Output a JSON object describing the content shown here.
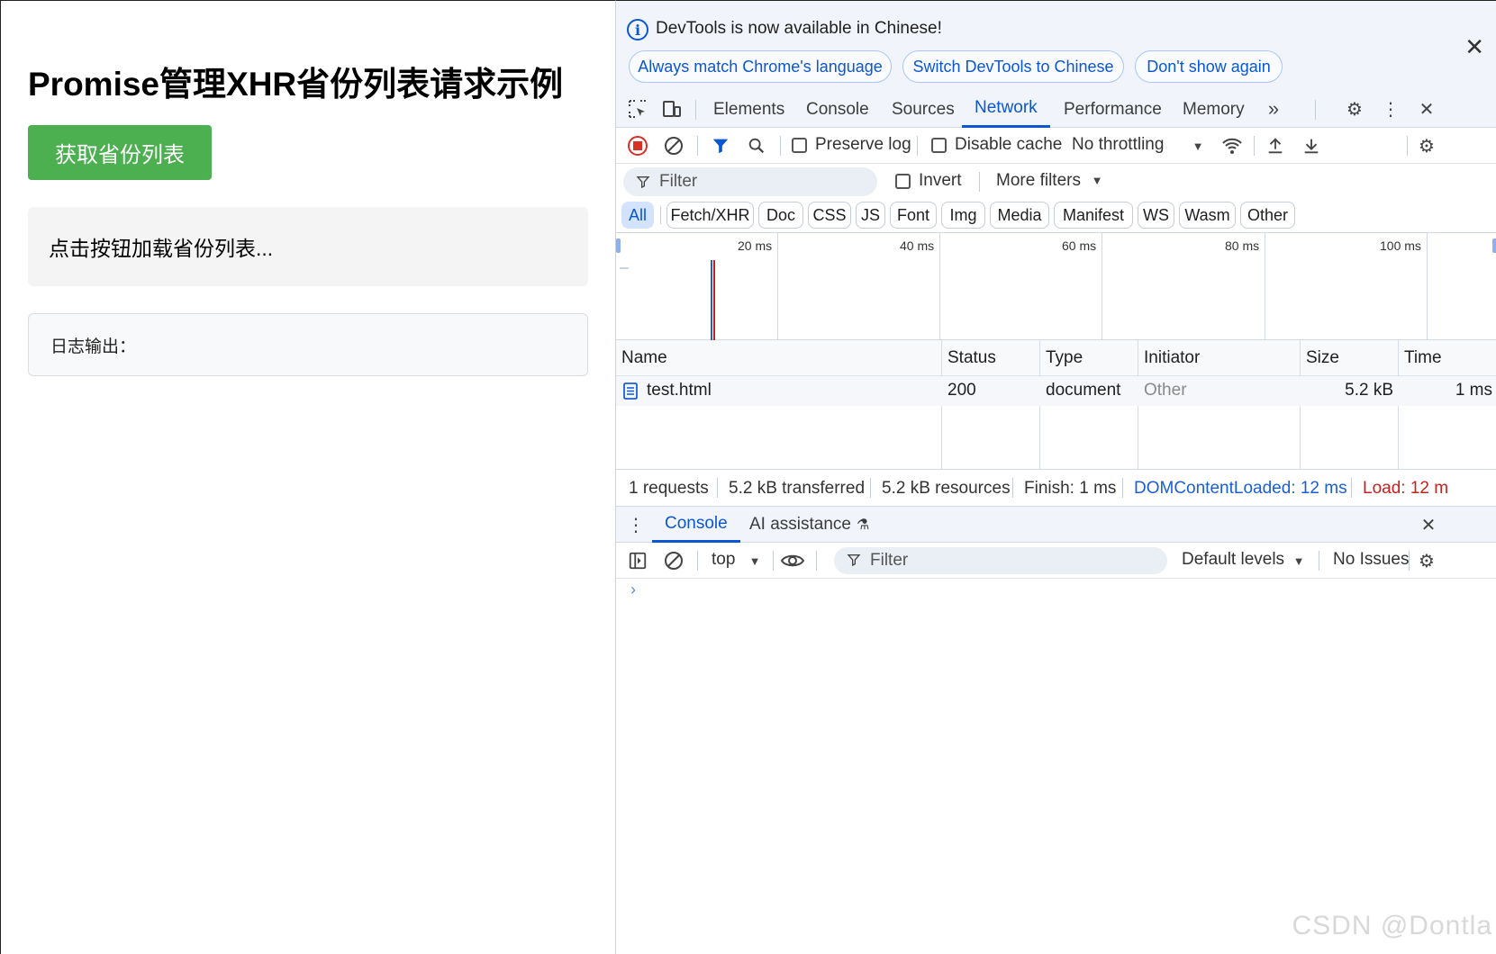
{
  "page": {
    "title": "Promise管理XHR省份列表请求示例",
    "button_label": "获取省份列表",
    "province_placeholder": "点击按钮加载省份列表...",
    "log_label": "日志输出："
  },
  "devtools": {
    "infobar": {
      "message": "DevTools is now available in Chinese!",
      "buttons": [
        "Always match Chrome's language",
        "Switch DevTools to Chinese",
        "Don't show again"
      ]
    },
    "tabs": [
      "Elements",
      "Console",
      "Sources",
      "Network",
      "Performance",
      "Memory"
    ],
    "active_tab": "Network",
    "network_toolbar": {
      "preserve_log": "Preserve log",
      "disable_cache": "Disable cache",
      "throttling": "No throttling"
    },
    "filter": {
      "placeholder": "Filter",
      "invert": "Invert",
      "more_filters": "More filters"
    },
    "type_filters": [
      "All",
      "Fetch/XHR",
      "Doc",
      "CSS",
      "JS",
      "Font",
      "Img",
      "Media",
      "Manifest",
      "WS",
      "Wasm",
      "Other"
    ],
    "timeline_ticks": [
      "20 ms",
      "40 ms",
      "60 ms",
      "80 ms",
      "100 ms"
    ],
    "table": {
      "columns": [
        "Name",
        "Status",
        "Type",
        "Initiator",
        "Size",
        "Time"
      ],
      "rows": [
        {
          "name": "test.html",
          "status": "200",
          "type": "document",
          "initiator": "Other",
          "size": "5.2 kB",
          "time": "1 ms"
        }
      ]
    },
    "summary": {
      "requests": "1 requests",
      "transferred": "5.2 kB transferred",
      "resources": "5.2 kB resources",
      "finish": "Finish: 1 ms",
      "dom_content_loaded": "DOMContentLoaded: 12 ms",
      "load": "Load: 12 m"
    },
    "drawer": {
      "tabs": [
        "Console",
        "AI assistance"
      ],
      "context": "top",
      "filter_placeholder": "Filter",
      "levels": "Default levels",
      "issues": "No Issues"
    },
    "colors": {
      "accent": "#0b57d0",
      "dcl": "#1a5fd6",
      "load": "#c5221f",
      "button_green": "#4caf50"
    }
  },
  "watermark": "CSDN @Dontla"
}
